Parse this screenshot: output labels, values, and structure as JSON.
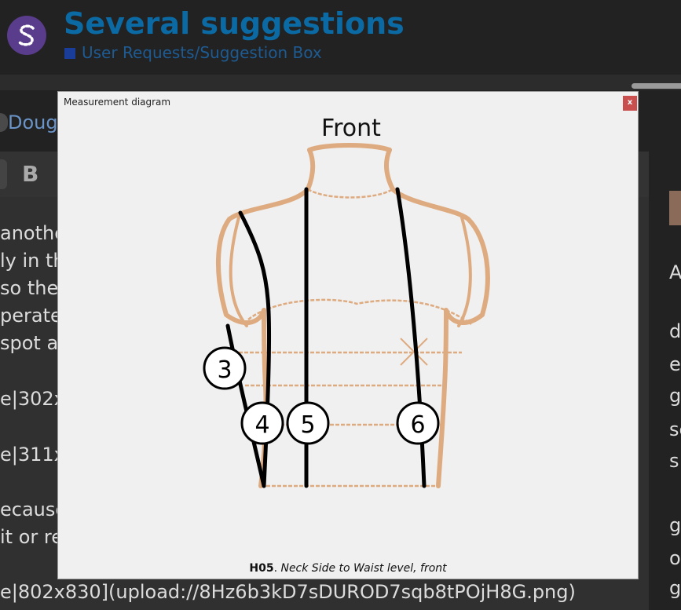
{
  "header": {
    "title": "Several suggestions",
    "category": "User Requests/Suggestion Box"
  },
  "post": {
    "author_partial": "Doug",
    "lines": [
      "anothe",
      "ly in th",
      "so they",
      "perate",
      "spot ar",
      "e|302x",
      "e|311x",
      "ecause",
      "it or re",
      "e|802x830](upload://8Hz6b3kD7sDUROD7sqb8tPOjH8G.png)"
    ]
  },
  "toolbar": {
    "bold_label": "B"
  },
  "right_panel": {
    "lines": [
      "A",
      "d",
      "er",
      "g",
      "se",
      "s",
      "g",
      "o",
      "g"
    ]
  },
  "modal": {
    "title": "Measurement diagram",
    "close_label": "x",
    "diagram_heading": "Front",
    "markers": [
      "3",
      "4",
      "5",
      "6"
    ],
    "caption_code": "H05",
    "caption_sep": ". ",
    "caption_text": "Neck Side to Waist level, front"
  },
  "colors": {
    "accent_title": "#0b6aa4",
    "category_square": "#1a3d9a",
    "torso_outline": "#deab80",
    "close_button": "#c94f4f"
  }
}
